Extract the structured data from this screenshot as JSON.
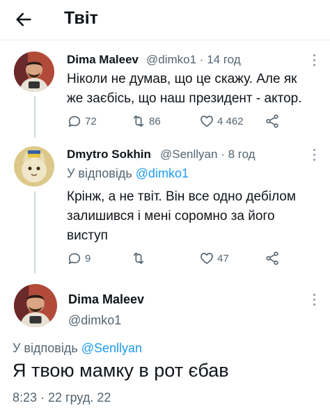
{
  "header": {
    "title": "Твіт"
  },
  "tweets": [
    {
      "name": "Dima Maleev",
      "handle": "@dimko1",
      "time": "14 год",
      "text_lines": [
        "Ніколи не думав, що це скажу. Але як",
        "же заєбісь, що наш президент - актор."
      ],
      "replies": "72",
      "retweets": "86",
      "likes": "4 462"
    },
    {
      "name": "Dmytro Sokhin",
      "handle": "@Senllyan",
      "time": "8 год",
      "reply_prefix": "У відповідь",
      "reply_handle": "@dimko1",
      "text_lines": [
        "Крінж, а не твіт. Він все одно дебілом",
        "залишився і мені соромно за його",
        "виступ"
      ],
      "replies": "9",
      "retweets": "",
      "likes": "47"
    }
  ],
  "main_tweet": {
    "name": "Dima Maleev",
    "handle": "@dimko1",
    "reply_prefix": "У відповідь",
    "reply_handle": "@Senllyan",
    "text": "Я твою мамку в рот єбав",
    "timestamp": "8:23 · 22 груд. 22"
  },
  "icons": {
    "back": "arrow-left-icon",
    "reply": "reply-icon",
    "retweet": "retweet-icon",
    "like": "heart-icon",
    "share": "share-icon",
    "more": "more-vertical-icon"
  },
  "colors": {
    "link": "#1d9bf0",
    "secondary": "#536471",
    "text": "#0f1419",
    "thread_line": "#cfd9de"
  }
}
